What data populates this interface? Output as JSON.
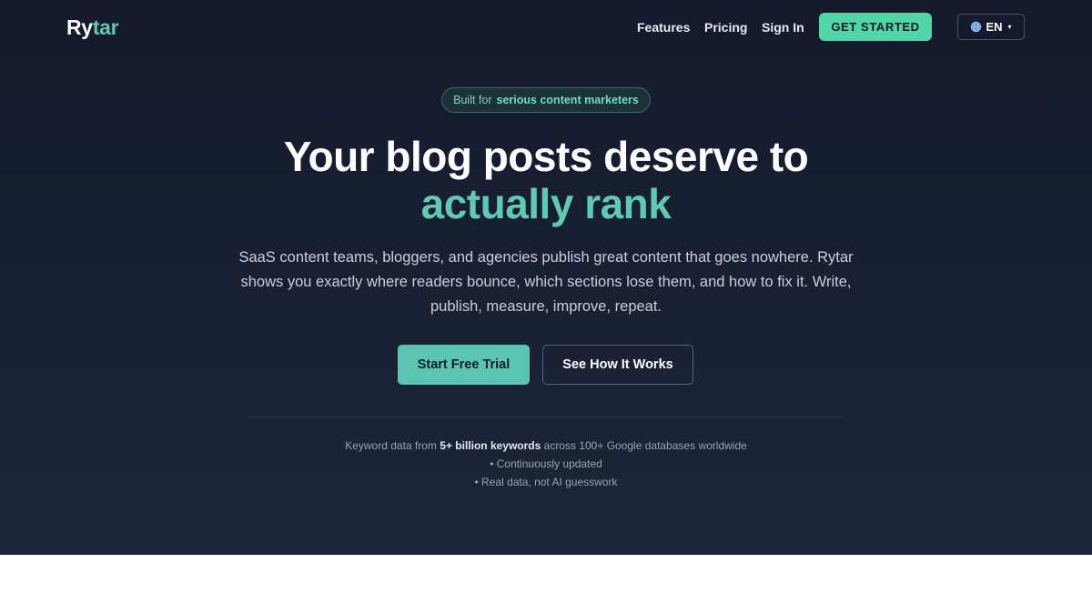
{
  "brand": {
    "name_main": "Ry",
    "name_accent": "tar"
  },
  "nav": {
    "links": [
      "Features",
      "Pricing",
      "Sign In"
    ],
    "cta": "GET STARTED",
    "language": {
      "icon": "globe-icon",
      "label": "EN",
      "caret": "▾"
    }
  },
  "hero": {
    "badge": {
      "prefix": "Built for",
      "highlight": "serious content marketers"
    },
    "headline_line1": "Your blog posts deserve to",
    "headline_line2": "actually rank",
    "subtitle": "SaaS content teams, bloggers, and agencies publish great content that goes nowhere. Rytar shows you exactly where readers bounce, which sections lose them, and how to fix it. Write, publish, measure, improve, repeat.",
    "primary_button": "Start Free Trial",
    "secondary_button": "See How It Works"
  },
  "stats": {
    "line1_prefix": "Keyword data from",
    "line1_bold": "5+ billion keywords",
    "line1_suffix": "across 100+ Google databases worldwide",
    "line2": "• Continuously updated",
    "line3": "• Real data, not AI guesswork"
  },
  "colors": {
    "accent": "#5fc9b4",
    "cta": "#52d5a7",
    "background": "#151a2c"
  }
}
